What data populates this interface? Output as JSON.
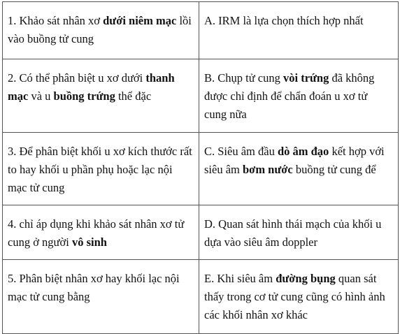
{
  "rows": [
    {
      "left": [
        {
          "t": "1. Khảo sát nhân xơ ",
          "b": false
        },
        {
          "t": "dưới niêm mạc",
          "b": true
        },
        {
          "t": " lồi vào buồng tử cung",
          "b": false
        }
      ],
      "right": [
        {
          "t": "A. IRM là lựa chọn thích hợp nhất",
          "b": false
        }
      ]
    },
    {
      "left": [
        {
          "t": "2. Có thể phân biệt u xơ dưới ",
          "b": false
        },
        {
          "t": "thanh mạc",
          "b": true
        },
        {
          "t": " và u ",
          "b": false
        },
        {
          "t": "buồng trứng",
          "b": true
        },
        {
          "t": " thể đặc",
          "b": false
        }
      ],
      "right": [
        {
          "t": "B. Chụp tử cung ",
          "b": false
        },
        {
          "t": "vòi trứng",
          "b": true
        },
        {
          "t": " đã không được chỉ định để chẩn đoán u xơ tử cung nữa",
          "b": false
        }
      ]
    },
    {
      "left": [
        {
          "t": "3. Để phân biệt khối u xơ kích thước rất to hay khối u phần phụ hoặc lạc nội mạc tử cung",
          "b": false
        }
      ],
      "right": [
        {
          "t": "C. Siêu âm đầu ",
          "b": false
        },
        {
          "t": "dò âm đạo",
          "b": true
        },
        {
          "t": " kết hợp với siêu âm ",
          "b": false
        },
        {
          "t": "bơm nước",
          "b": true
        },
        {
          "t": " buồng tử cung để",
          "b": false
        }
      ]
    },
    {
      "left": [
        {
          "t": "4. chỉ áp dụng khi khảo sát nhân xơ tử cung ở người ",
          "b": false
        },
        {
          "t": "vô sinh",
          "b": true
        }
      ],
      "right": [
        {
          "t": "D. Quan sát hình thái mạch của khối u dựa vào siêu âm doppler",
          "b": false
        }
      ]
    },
    {
      "left": [
        {
          "t": "5. Phân biệt nhân xơ hay khối lạc nội mạc tử cung bằng",
          "b": false
        }
      ],
      "right": [
        {
          "t": "E. Khi siêu âm ",
          "b": false
        },
        {
          "t": "đường bụng",
          "b": true
        },
        {
          "t": " quan sát thấy trong cơ tử cung cũng có hình ảnh các khối nhân xơ khác",
          "b": false
        }
      ]
    }
  ]
}
